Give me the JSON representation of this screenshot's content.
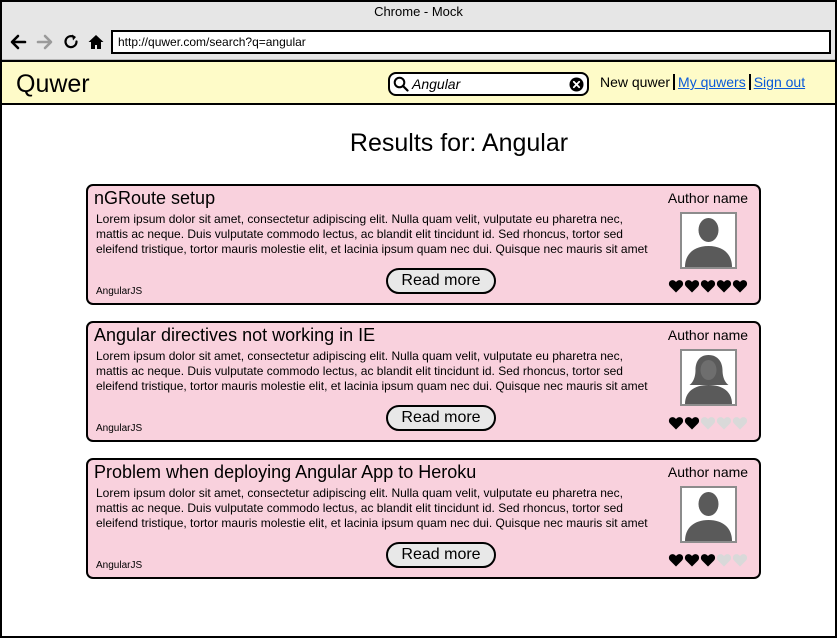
{
  "browser": {
    "title": "Chrome - Mock",
    "url": "http://quwer.com/search?q=angular"
  },
  "app": {
    "logo": "Quwer",
    "search_value": "Angular",
    "nav": {
      "new": "New quwer",
      "my": "My quwers",
      "signout": "Sign out"
    }
  },
  "results_title": "Results for: Angular",
  "read_more_label": "Read more",
  "cards": [
    {
      "title": "nGRoute setup",
      "body": "Lorem ipsum dolor sit amet, consectetur adipiscing elit. Nulla quam velit, vulputate eu pharetra nec, mattis ac neque. Duis vulputate commodo lectus, ac blandit elit tincidunt id. Sed rhoncus, tortor sed eleifend tristique, tortor mauris molestie elit, et lacinia ipsum quam nec dui. Quisque nec mauris sit amet",
      "tag": "AngularJS",
      "author": "Author name",
      "avatar": "male-avatar-icon",
      "rating": 5
    },
    {
      "title": "Angular directives not working in IE",
      "body": "Lorem ipsum dolor sit amet, consectetur adipiscing elit. Nulla quam velit, vulputate eu pharetra nec, mattis ac neque. Duis vulputate commodo lectus, ac blandit elit tincidunt id. Sed rhoncus, tortor sed eleifend tristique, tortor mauris molestie elit, et lacinia ipsum quam nec dui. Quisque nec mauris sit amet",
      "tag": "AngularJS",
      "author": "Author name",
      "avatar": "female-avatar-icon",
      "rating": 2
    },
    {
      "title": "Problem when deploying Angular App to Heroku",
      "body": "Lorem ipsum dolor sit amet, consectetur adipiscing elit. Nulla quam velit, vulputate eu pharetra nec, mattis ac neque. Duis vulputate commodo lectus, ac blandit elit tincidunt id. Sed rhoncus, tortor sed eleifend tristique, tortor mauris molestie elit, et lacinia ipsum quam nec dui. Quisque nec mauris sit amet",
      "tag": "AngularJS",
      "author": "Author name",
      "avatar": "male-avatar-icon",
      "rating": 3
    }
  ],
  "colors": {
    "header_bg": "#fefbc8",
    "card_bg": "#f9d1dd",
    "link": "#0a5ad8",
    "heart_on": "#000000",
    "heart_off": "#d9d9d9"
  }
}
